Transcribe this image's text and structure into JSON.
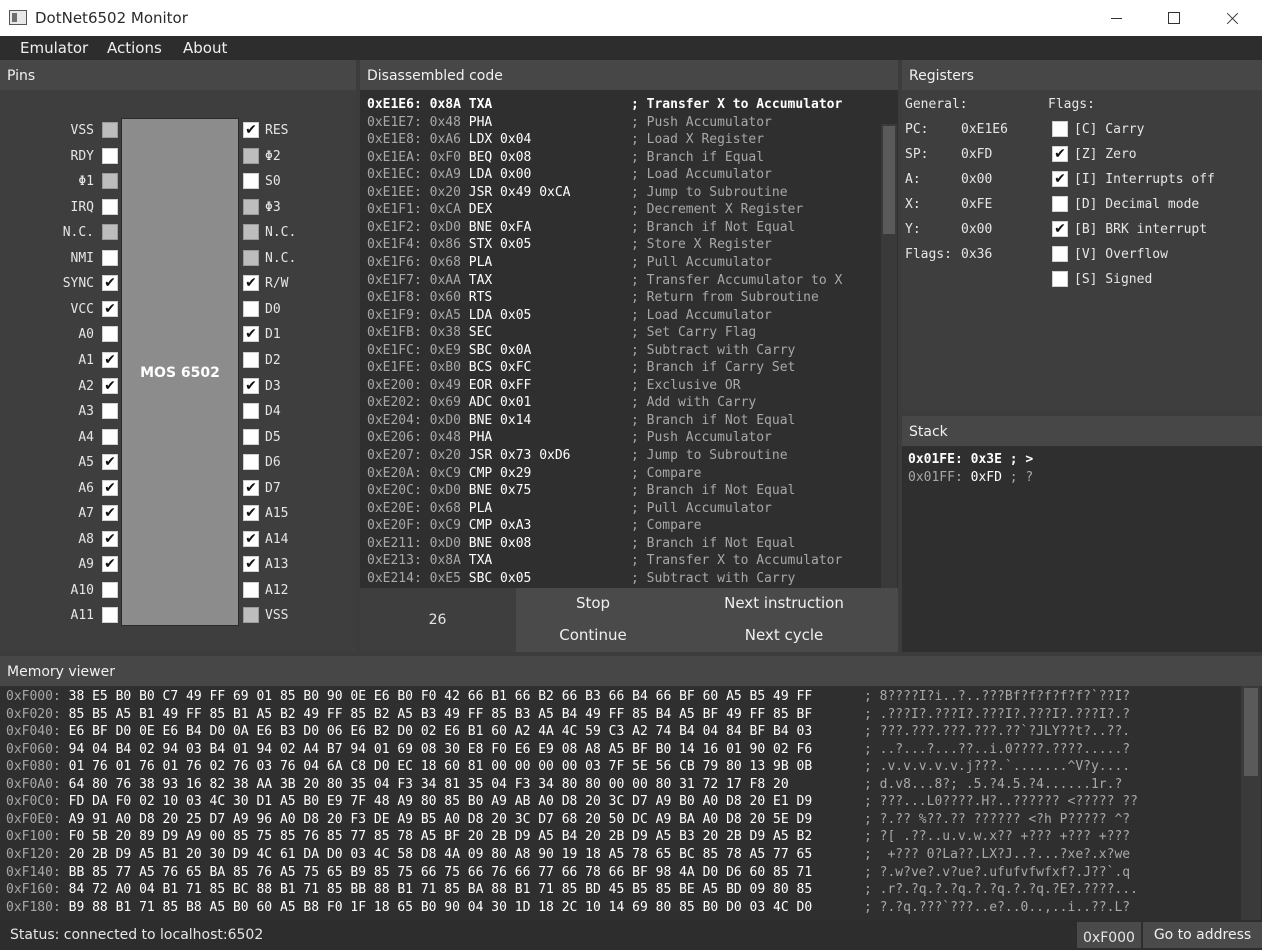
{
  "window": {
    "title": "DotNet6502 Monitor"
  },
  "menu": [
    "Emulator",
    "Actions",
    "About"
  ],
  "pins": {
    "header": "Pins",
    "chip_label": "MOS 6502",
    "left": [
      {
        "label": "VSS",
        "checked": false,
        "disabled": true
      },
      {
        "label": "RDY",
        "checked": false,
        "disabled": false
      },
      {
        "label": "Φ1",
        "checked": false,
        "disabled": true
      },
      {
        "label": "IRQ",
        "checked": false,
        "disabled": false
      },
      {
        "label": "N.C.",
        "checked": false,
        "disabled": true
      },
      {
        "label": "NMI",
        "checked": false,
        "disabled": false
      },
      {
        "label": "SYNC",
        "checked": true,
        "disabled": false
      },
      {
        "label": "VCC",
        "checked": true,
        "disabled": false
      },
      {
        "label": "A0",
        "checked": false,
        "disabled": false
      },
      {
        "label": "A1",
        "checked": true,
        "disabled": false
      },
      {
        "label": "A2",
        "checked": true,
        "disabled": false
      },
      {
        "label": "A3",
        "checked": false,
        "disabled": false
      },
      {
        "label": "A4",
        "checked": false,
        "disabled": false
      },
      {
        "label": "A5",
        "checked": true,
        "disabled": false
      },
      {
        "label": "A6",
        "checked": true,
        "disabled": false
      },
      {
        "label": "A7",
        "checked": true,
        "disabled": false
      },
      {
        "label": "A8",
        "checked": true,
        "disabled": false
      },
      {
        "label": "A9",
        "checked": true,
        "disabled": false
      },
      {
        "label": "A10",
        "checked": false,
        "disabled": false
      },
      {
        "label": "A11",
        "checked": false,
        "disabled": false
      }
    ],
    "right": [
      {
        "label": "RES",
        "checked": true,
        "disabled": false
      },
      {
        "label": "Φ2",
        "checked": false,
        "disabled": true
      },
      {
        "label": "S0",
        "checked": false,
        "disabled": false
      },
      {
        "label": "Φ3",
        "checked": false,
        "disabled": true
      },
      {
        "label": "N.C.",
        "checked": false,
        "disabled": true
      },
      {
        "label": "N.C.",
        "checked": false,
        "disabled": true
      },
      {
        "label": "R/W",
        "checked": true,
        "disabled": false
      },
      {
        "label": "D0",
        "checked": false,
        "disabled": false
      },
      {
        "label": "D1",
        "checked": true,
        "disabled": false
      },
      {
        "label": "D2",
        "checked": false,
        "disabled": false
      },
      {
        "label": "D3",
        "checked": true,
        "disabled": false
      },
      {
        "label": "D4",
        "checked": false,
        "disabled": false
      },
      {
        "label": "D5",
        "checked": false,
        "disabled": false
      },
      {
        "label": "D6",
        "checked": false,
        "disabled": false
      },
      {
        "label": "D7",
        "checked": true,
        "disabled": false
      },
      {
        "label": "A15",
        "checked": true,
        "disabled": false
      },
      {
        "label": "A14",
        "checked": true,
        "disabled": false
      },
      {
        "label": "A13",
        "checked": true,
        "disabled": false
      },
      {
        "label": "A12",
        "checked": false,
        "disabled": false
      },
      {
        "label": "VSS",
        "checked": false,
        "disabled": true
      }
    ]
  },
  "disassembly": {
    "header": "Disassembled code",
    "current_index": 0,
    "lines": [
      {
        "addr": "0xE1E6: 0x8A",
        "op": "TXA",
        "comment": "; Transfer X to Accumulator"
      },
      {
        "addr": "0xE1E7: 0x48",
        "op": "PHA",
        "comment": "; Push Accumulator"
      },
      {
        "addr": "0xE1E8: 0xA6",
        "op": "LDX 0x04",
        "comment": "; Load X Register"
      },
      {
        "addr": "0xE1EA: 0xF0",
        "op": "BEQ 0x08",
        "comment": "; Branch if Equal"
      },
      {
        "addr": "0xE1EC: 0xA9",
        "op": "LDA 0x00",
        "comment": "; Load Accumulator"
      },
      {
        "addr": "0xE1EE: 0x20",
        "op": "JSR 0x49 0xCA",
        "comment": "; Jump to Subroutine"
      },
      {
        "addr": "0xE1F1: 0xCA",
        "op": "DEX",
        "comment": "; Decrement X Register"
      },
      {
        "addr": "0xE1F2: 0xD0",
        "op": "BNE 0xFA",
        "comment": "; Branch if Not Equal"
      },
      {
        "addr": "0xE1F4: 0x86",
        "op": "STX 0x05",
        "comment": "; Store X Register"
      },
      {
        "addr": "0xE1F6: 0x68",
        "op": "PLA",
        "comment": "; Pull Accumulator"
      },
      {
        "addr": "0xE1F7: 0xAA",
        "op": "TAX",
        "comment": "; Transfer Accumulator to X"
      },
      {
        "addr": "0xE1F8: 0x60",
        "op": "RTS",
        "comment": "; Return from Subroutine"
      },
      {
        "addr": "0xE1F9: 0xA5",
        "op": "LDA 0x05",
        "comment": "; Load Accumulator"
      },
      {
        "addr": "0xE1FB: 0x38",
        "op": "SEC",
        "comment": "; Set Carry Flag"
      },
      {
        "addr": "0xE1FC: 0xE9",
        "op": "SBC 0x0A",
        "comment": "; Subtract with Carry"
      },
      {
        "addr": "0xE1FE: 0xB0",
        "op": "BCS 0xFC",
        "comment": "; Branch if Carry Set"
      },
      {
        "addr": "0xE200: 0x49",
        "op": "EOR 0xFF",
        "comment": "; Exclusive OR"
      },
      {
        "addr": "0xE202: 0x69",
        "op": "ADC 0x01",
        "comment": "; Add with Carry"
      },
      {
        "addr": "0xE204: 0xD0",
        "op": "BNE 0x14",
        "comment": "; Branch if Not Equal"
      },
      {
        "addr": "0xE206: 0x48",
        "op": "PHA",
        "comment": "; Push Accumulator"
      },
      {
        "addr": "0xE207: 0x20",
        "op": "JSR 0x73 0xD6",
        "comment": "; Jump to Subroutine"
      },
      {
        "addr": "0xE20A: 0xC9",
        "op": "CMP 0x29",
        "comment": "; Compare"
      },
      {
        "addr": "0xE20C: 0xD0",
        "op": "BNE 0x75",
        "comment": "; Branch if Not Equal"
      },
      {
        "addr": "0xE20E: 0x68",
        "op": "PLA",
        "comment": "; Pull Accumulator"
      },
      {
        "addr": "0xE20F: 0xC9",
        "op": "CMP 0xA3",
        "comment": "; Compare"
      },
      {
        "addr": "0xE211: 0xD0",
        "op": "BNE 0x08",
        "comment": "; Branch if Not Equal"
      },
      {
        "addr": "0xE213: 0x8A",
        "op": "TXA",
        "comment": "; Transfer X to Accumulator"
      },
      {
        "addr": "0xE214: 0xE5",
        "op": "SBC 0x05",
        "comment": "; Subtract with Carry"
      }
    ],
    "cycle_count": "26",
    "buttons": {
      "stop": "Stop",
      "continue": "Continue",
      "next_instruction": "Next instruction",
      "next_cycle": "Next cycle"
    }
  },
  "registers": {
    "header": "Registers",
    "general_label": "General:",
    "flags_label": "Flags:",
    "general": [
      {
        "name": "PC:",
        "value": "0xE1E6"
      },
      {
        "name": "SP:",
        "value": "0xFD"
      },
      {
        "name": "A:",
        "value": "0x00"
      },
      {
        "name": "X:",
        "value": "0xFE"
      },
      {
        "name": "Y:",
        "value": "0x00"
      },
      {
        "name": "Flags:",
        "value": "0x36"
      }
    ],
    "flags": [
      {
        "label": "[C] Carry",
        "checked": false
      },
      {
        "label": "[Z] Zero",
        "checked": true
      },
      {
        "label": "[I] Interrupts off",
        "checked": true
      },
      {
        "label": "[D] Decimal mode",
        "checked": false
      },
      {
        "label": "[B] BRK interrupt",
        "checked": true
      },
      {
        "label": "[V] Overflow",
        "checked": false
      },
      {
        "label": "[S] Signed",
        "checked": false
      }
    ]
  },
  "stack": {
    "header": "Stack",
    "top_index": 0,
    "lines": [
      {
        "addr": "0x01FE:",
        "value": "0x3E",
        "comment": "; >"
      },
      {
        "addr": "0x01FF:",
        "value": "0xFD",
        "comment": "; ?"
      }
    ]
  },
  "memory": {
    "header": "Memory viewer",
    "lines": [
      {
        "addr": "0xF000:",
        "bytes": "38 E5 B0 B0 C7 49 FF 69 01 85 B0 90 0E E6 B0 F0 42 66 B1 66 B2 66 B3 66 B4 66 BF 60 A5 B5 49 FF",
        "chars": "; 8????I?i..?..???Bf?f?f?f?f?`??I?"
      },
      {
        "addr": "0xF020:",
        "bytes": "85 B5 A5 B1 49 FF 85 B1 A5 B2 49 FF 85 B2 A5 B3 49 FF 85 B3 A5 B4 49 FF 85 B4 A5 BF 49 FF 85 BF",
        "chars": "; .???I?.???I?.???I?.???I?.???I?.?"
      },
      {
        "addr": "0xF040:",
        "bytes": "E6 BF D0 0E E6 B4 D0 0A E6 B3 D0 06 E6 B2 D0 02 E6 B1 60 A2 4A 4C 59 C3 A2 74 B4 04 84 BF B4 03",
        "chars": "; ???.???.???.???.??`?JLY??t?..??."
      },
      {
        "addr": "0xF060:",
        "bytes": "94 04 B4 02 94 03 B4 01 94 02 A4 B7 94 01 69 08 30 E8 F0 E6 E9 08 A8 A5 BF B0 14 16 01 90 02 F6",
        "chars": "; ..?...?...??..i.0????.????.....?"
      },
      {
        "addr": "0xF080:",
        "bytes": "01 76 01 76 01 76 02 76 03 76 04 6A C8 D0 EC 18 60 81 00 00 00 00 03 7F 5E 56 CB 79 80 13 9B 0B",
        "chars": "; .v.v.v.v.v.j???.`.......^V?y...."
      },
      {
        "addr": "0xF0A0:",
        "bytes": "64 80 76 38 93 16 82 38 AA 3B 20 80 35 04 F3 34 81 35 04 F3 34 80 80 00 00 80 31 72 17 F8 20",
        "chars": "; d.v8...8?; .5.?4.5.?4......1r.?"
      },
      {
        "addr": "0xF0C0:",
        "bytes": "FD DA F0 02 10 03 4C 30 D1 A5 B0 E9 7F 48 A9 80 85 B0 A9 AB A0 D8 20 3C D7 A9 B0 A0 D8 20 E1 D9",
        "chars": "; ???...L0????.H?..?????? <????? ??"
      },
      {
        "addr": "0xF0E0:",
        "bytes": "A9 91 A0 D8 20 25 D7 A9 96 A0 D8 20 F3 DE A9 B5 A0 D8 20 3C D7 68 20 50 DC A9 BA A0 D8 20 5E D9",
        "chars": "; ?.?? %??.?? ?????? <?h P????? ^?"
      },
      {
        "addr": "0xF100:",
        "bytes": "F0 5B 20 89 D9 A9 00 85 75 85 76 85 77 85 78 A5 BF 20 2B D9 A5 B4 20 2B D9 A5 B3 20 2B D9 A5 B2",
        "chars": "; ?[ .??..u.v.w.x?? +??? +??? +???"
      },
      {
        "addr": "0xF120:",
        "bytes": "20 2B D9 A5 B1 20 30 D9 4C 61 DA D0 03 4C 58 D8 4A 09 80 A8 90 19 18 A5 78 65 BC 85 78 A5 77 65",
        "chars": ";  +??? 0?La??.LX?J..?...?xe?.x?we"
      },
      {
        "addr": "0xF140:",
        "bytes": "BB 85 77 A5 76 65 BA 85 76 A5 75 65 B9 85 75 66 75 66 76 66 77 66 78 66 BF 98 4A D0 D6 60 85 71",
        "chars": "; ?.w?ve?.v?ue?.ufufvfwfxf?.J??`.q"
      },
      {
        "addr": "0xF160:",
        "bytes": "84 72 A0 04 B1 71 85 BC 88 B1 71 85 BB 88 B1 71 85 BA 88 B1 71 85 BD 45 B5 85 BE A5 BD 09 80 85",
        "chars": "; .r?.?q.?.?q.?.?q.?.?q.?E?.????..."
      },
      {
        "addr": "0xF180:",
        "bytes": "B9 88 B1 71 85 B8 A5 B0 60 A5 B8 F0 1F 18 65 B0 90 04 30 1D 18 2C 10 14 69 80 85 B0 D0 03 4C D0",
        "chars": "; ?.?q.???`???..e?..0..,..i..??.L?"
      }
    ]
  },
  "status": {
    "text": "Status: connected to localhost:6502",
    "address_value": "0xF000",
    "goto_label": "Go to address"
  }
}
